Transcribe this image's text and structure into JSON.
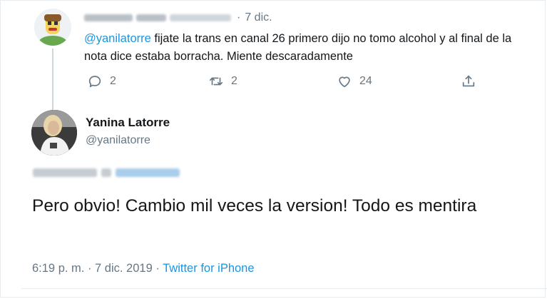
{
  "parent_tweet": {
    "date": "7 dic.",
    "mention": "@yanilatorre",
    "text": " fijate la trans en canal 26 primero dijo no tomo alcohol y al final de la nota dice estaba borracha. Miente descaradamente",
    "actions": {
      "reply_count": "2",
      "retweet_count": "2",
      "like_count": "24"
    },
    "icons": [
      "reply-icon",
      "retweet-icon",
      "like-icon",
      "share-icon"
    ]
  },
  "reply_tweet": {
    "name": "Yanina Latorre",
    "handle": "@yanilatorre",
    "text": "Pero obvio! Cambio mil veces la version! Todo es mentira",
    "time": "6:19 p. m. · 7 dic. 2019 · ",
    "source": "Twitter for iPhone"
  },
  "colors": {
    "link": "#1b95e0",
    "muted": "#657786",
    "text": "#14171a",
    "thread_line": "#ccd6dd"
  }
}
